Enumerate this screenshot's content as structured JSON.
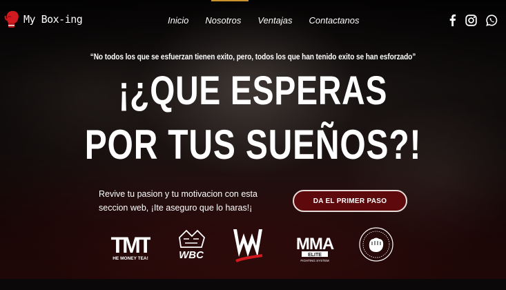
{
  "brand": {
    "name": "My Box-ing"
  },
  "nav": {
    "items": [
      {
        "label": "Inicio"
      },
      {
        "label": "Nosotros"
      },
      {
        "label": "Ventajas"
      },
      {
        "label": "Contactanos"
      }
    ]
  },
  "social": [
    "facebook-icon",
    "instagram-icon",
    "whatsapp-icon"
  ],
  "hero": {
    "quote": "“No todos los que se esfuerzan tienen exito, pero, todos los que han tenido exito se han esforzado”",
    "headline_line1": "¡¿QUE ESPERAS",
    "headline_line2": "POR TUS SUEÑOS?!",
    "subtext_line1": "Revive tu pasion y tu motivacion con esta",
    "subtext_line2": "seccion web, ¡Ite aseguro que lo haras!¡",
    "cta_label": "DA EL PRIMER PASO"
  },
  "partners": {
    "tmt": {
      "mark": "TMT",
      "caption": "HE MONEY TEA!"
    },
    "wbc": {
      "mark": "WBC"
    },
    "wwe": {
      "mark": "W"
    },
    "mma": {
      "mark": "MMA",
      "sub": "ELITE",
      "caption": "FIGHTING SYSTEM"
    },
    "seal": {
      "name": "seal-logo"
    }
  },
  "colors": {
    "cta_fill": "#5e0a0d",
    "accent": "#c9922e",
    "glove": "#d11a1f"
  }
}
